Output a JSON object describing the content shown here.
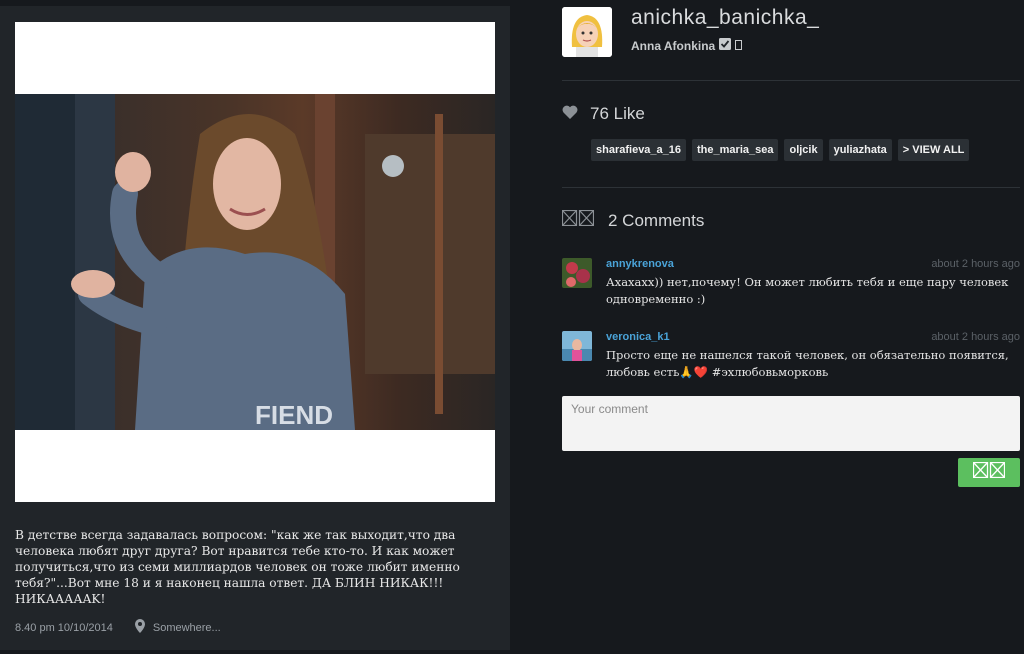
{
  "post": {
    "caption": "В детстве всегда задавалась вопросом: \"как же так выходит,что два человека любят друг друга? Вот нравится тебе кто-то. И как может получиться,что из семи миллиардов человек он тоже любит именно тебя?\"...Вот мне 18 и я наконец нашла ответ. ДА БЛИН НИКАК!!! НИКААААAK!",
    "timestamp": "8.40 pm 10/10/2014",
    "location": "Somewhere...",
    "photo_print_text": "FIEND"
  },
  "profile": {
    "username": "anichka_banichka_",
    "full_name": "Anna Afonkina"
  },
  "likes": {
    "count_label": "76 Like",
    "likers": [
      "sharafieva_a_16",
      "the_maria_sea",
      "oljcik",
      "yuliazhata"
    ],
    "view_all_label": "> VIEW ALL"
  },
  "comments": {
    "header": "2 Comments",
    "items": [
      {
        "user": "annykrenova",
        "time": "about 2 hours ago",
        "text": "Ахахахх)) нет,почему! Он может любить тебя и еще пару человек одновременно :)"
      },
      {
        "user": "veronica_k1",
        "time": "about 2 hours ago",
        "text": "Просто еще не нашелся такой человек, он обязательно появится, любовь есть🙏❤️ #эхлюбовьморковь"
      }
    ],
    "input_placeholder": "Your comment"
  },
  "colors": {
    "background": "#16191d",
    "card": "#212529",
    "link": "#4aa3d8",
    "send_button": "#5cbf5f"
  }
}
